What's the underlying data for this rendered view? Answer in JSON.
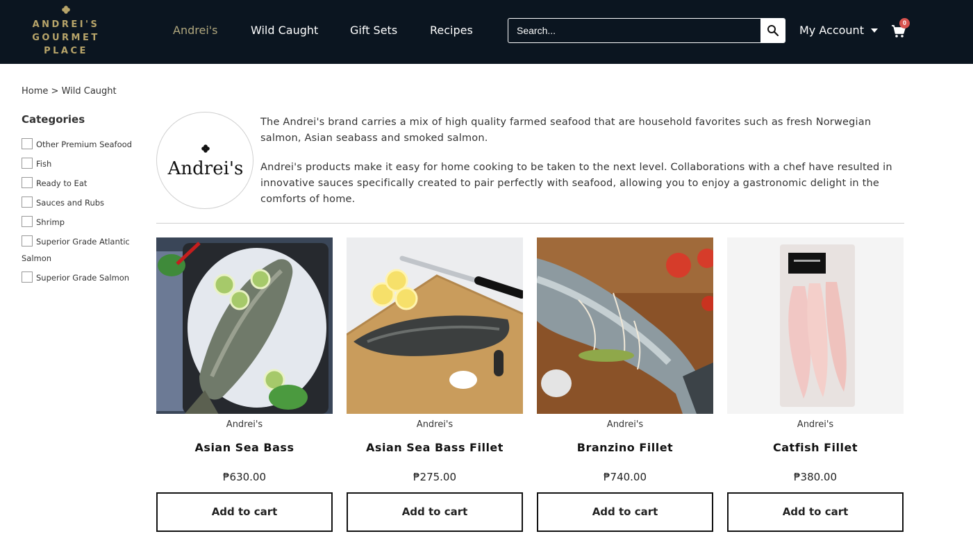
{
  "header": {
    "logo": {
      "line1": "ANDREI'S",
      "line2": "GOURMET",
      "line3": "PLACE",
      "icon": "clover-icon"
    },
    "nav": [
      "Andrei's",
      "Wild Caught",
      "Gift Sets",
      "Recipes"
    ],
    "active_nav": "Andrei's",
    "search": {
      "placeholder": "Search...",
      "value": "",
      "icon": "search-icon"
    },
    "account": {
      "label": "My Account",
      "icon": "chevron-down-icon"
    },
    "cart": {
      "count": "0",
      "icon": "cart-icon"
    }
  },
  "breadcrumb": {
    "home": "Home",
    "separator": ">",
    "current": "Wild Caught"
  },
  "sidebar": {
    "title": "Categories",
    "categories": [
      "Other Premium Seafood",
      "Fish",
      "Ready to Eat",
      "Sauces and Rubs",
      "Shrimp",
      "Superior Grade Atlantic Salmon",
      "Superior Grade Salmon"
    ]
  },
  "brand": {
    "logo_text": "Andrei's",
    "paragraphs": [
      "The Andrei's brand carries a mix of high quality farmed seafood that are household favorites such as fresh Norwegian salmon, Asian seabass and smoked salmon.",
      "Andrei's products make it easy for home cooking to be taken to the next level. Collaborations with a chef have resulted in innovative sauces specifically created to pair perfectly with seafood, allowing you to enjoy a gastronomic delight in the comforts of home."
    ]
  },
  "products": [
    {
      "vendor": "Andrei's",
      "name": "Asian Sea Bass",
      "price": "₱630.00",
      "button": "Add to cart"
    },
    {
      "vendor": "Andrei's",
      "name": "Asian Sea Bass Fillet",
      "price": "₱275.00",
      "button": "Add to cart"
    },
    {
      "vendor": "Andrei's",
      "name": "Branzino Fillet",
      "price": "₱740.00",
      "button": "Add to cart"
    },
    {
      "vendor": "Andrei's",
      "name": "Catfish Fillet",
      "price": "₱380.00",
      "button": "Add to cart"
    }
  ],
  "colors": {
    "header_bg": "#0b1520",
    "logo_gold": "#b8a56a",
    "active_nav": "#b0a77e",
    "badge": "#d9534f"
  }
}
